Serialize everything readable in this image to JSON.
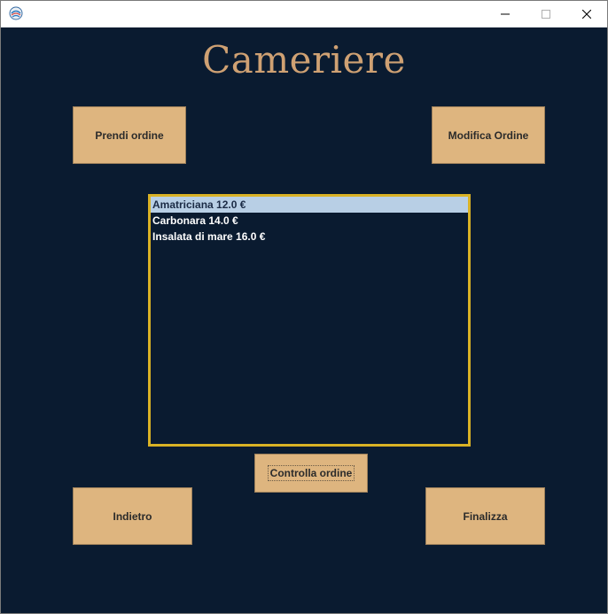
{
  "window": {
    "controls": {
      "minimize": "—",
      "maximize": "☐",
      "close": "✕"
    }
  },
  "title": "Cameriere",
  "buttons": {
    "prendi_ordine": "Prendi ordine",
    "modifica_ordine": "Modifica Ordine",
    "controlla_ordine": "Controlla ordine",
    "indietro": "Indietro",
    "finalizza": "Finalizza"
  },
  "order_list": {
    "items": [
      "Amatriciana 12.0 €",
      "Carbonara 14.0 €",
      "Insalata di mare 16.0 €"
    ],
    "selected_index": 0
  },
  "colors": {
    "background": "#0a1b30",
    "accent": "#cfa173",
    "button": "#deb57f",
    "list_border": "#d9b225",
    "selection": "#b8cfe5"
  }
}
